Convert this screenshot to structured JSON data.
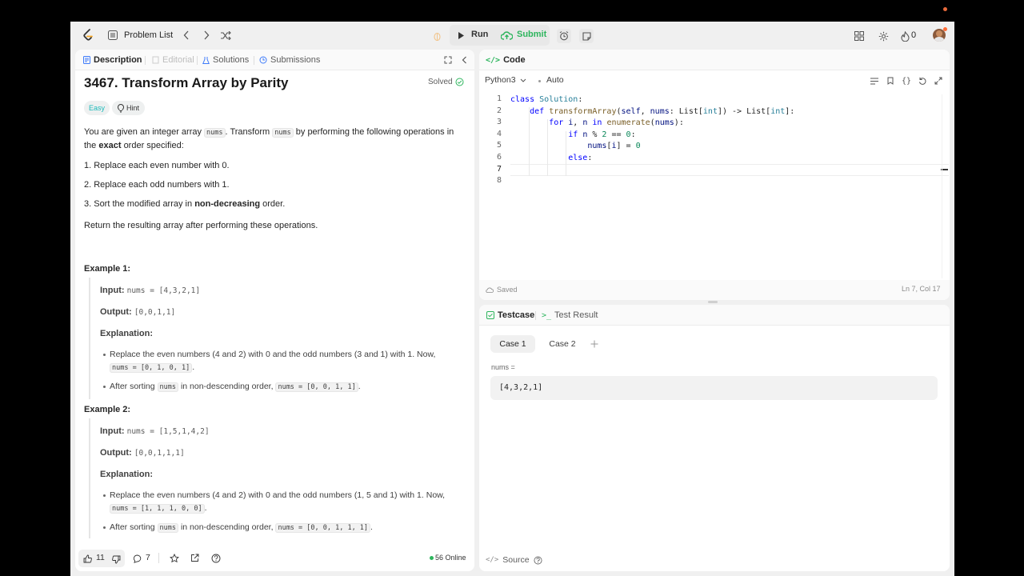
{
  "topbar": {
    "problem_list": "Problem List",
    "run": "Run",
    "submit": "Submit",
    "streak_count": "0"
  },
  "left": {
    "tabs": [
      "Description",
      "Editorial",
      "Solutions",
      "Submissions"
    ],
    "title": "3467. Transform Array by Parity",
    "solved": "Solved",
    "difficulty": "Easy",
    "hint": "Hint",
    "intro_1": "You are given an integer array",
    "intro_code_1": "nums",
    "intro_2": ". Transform",
    "intro_code_2": "nums",
    "intro_3": "by performing the following operations in the",
    "intro_bold": "exact",
    "intro_4": "order specified:",
    "step_1": "1. Replace each even number with 0.",
    "step_2": "2. Replace each odd numbers with 1.",
    "step_3a": "3. Sort the modified array in",
    "step_3b": "non-decreasing",
    "step_3c": "order.",
    "return_text": "Return the resulting array after performing these operations.",
    "examples": [
      {
        "heading": "Example 1:",
        "input_label": "Input:",
        "input": "nums = [4,3,2,1]",
        "output_label": "Output:",
        "output": "[0,0,1,1]",
        "explanation_label": "Explanation:",
        "bullet_1": "Replace the even numbers (4 and 2) with 0 and the odd numbers (3 and 1) with 1. Now,",
        "bullet_1_code": "nums = [0, 1, 0, 1]",
        "bullet_2a": "After sorting",
        "bullet_2_code1": "nums",
        "bullet_2b": "in non-descending order,",
        "bullet_2_code2": "nums = [0, 0, 1, 1]"
      },
      {
        "heading": "Example 2:",
        "input_label": "Input:",
        "input": "nums = [1,5,1,4,2]",
        "output_label": "Output:",
        "output": "[0,0,1,1,1]",
        "explanation_label": "Explanation:",
        "bullet_1": "Replace the even numbers (4 and 2) with 0 and the odd numbers (1, 5 and 1) with 1. Now,",
        "bullet_1_code": "nums = [1, 1, 1, 0, 0]",
        "bullet_2a": "After sorting",
        "bullet_2_code1": "nums",
        "bullet_2b": "in non-descending order,",
        "bullet_2_code2": "nums = [0, 0, 1, 1, 1]"
      }
    ],
    "likes": "11",
    "comments": "7",
    "online": "56 Online"
  },
  "code": {
    "tab": "Code",
    "language": "Python3",
    "mode": "Auto",
    "saved": "Saved",
    "cursor": "Ln 7, Col 17",
    "line_numbers": [
      "1",
      "2",
      "3",
      "4",
      "5",
      "6",
      "7",
      "8"
    ]
  },
  "testcase": {
    "tab_1": "Testcase",
    "tab_2": "Test Result",
    "cases": [
      "Case 1",
      "Case 2"
    ],
    "param_label": "nums =",
    "param_value": "[4,3,2,1]",
    "source": "Source"
  },
  "colors": {
    "submit_green": "#2db55d",
    "easy": "#1cbaba",
    "solved_green": "#2db55d",
    "online_dot": "#2db55d",
    "accent_orange": "#ffa116"
  },
  "icons": [
    "logo-icon",
    "problem-list-icon",
    "chevron-left-icon",
    "chevron-right-icon",
    "shuffle-icon",
    "bug-icon",
    "play-icon",
    "cloud-upload-icon",
    "alarm-icon",
    "note-icon",
    "grid-icon",
    "gear-icon",
    "flame-icon",
    "avatar"
  ]
}
